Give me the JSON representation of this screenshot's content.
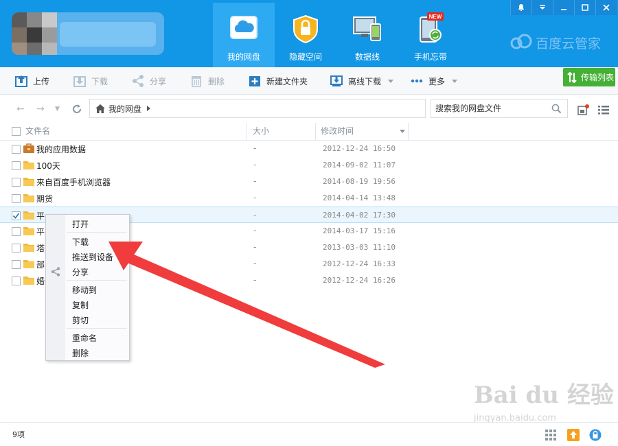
{
  "header": {
    "tabs": [
      {
        "label": "我的网盘",
        "icon": "cloud-drive-icon",
        "active": true
      },
      {
        "label": "隐藏空间",
        "icon": "lock-icon",
        "active": false
      },
      {
        "label": "数据线",
        "icon": "device-sync-icon",
        "active": false
      },
      {
        "label": "手机忘带",
        "icon": "phone-sync-icon",
        "active": false,
        "badge": "NEW"
      }
    ],
    "brand": "百度云管家",
    "window_controls": [
      "bell-icon",
      "dropdown-icon",
      "minimize-icon",
      "maximize-icon",
      "close-icon"
    ]
  },
  "toolbar": {
    "upload": "上传",
    "download": "下载",
    "share": "分享",
    "delete": "删除",
    "new_folder": "新建文件夹",
    "offline_download": "离线下载",
    "more": "更多",
    "transfer_list": "传输列表"
  },
  "address": {
    "breadcrumb": "我的网盘",
    "search_placeholder": "搜索我的网盘文件"
  },
  "list": {
    "columns": {
      "name": "文件名",
      "size": "大小",
      "modified": "修改时间"
    },
    "rows": [
      {
        "name": "我的应用数据",
        "size": "-",
        "time": "2012-12-24 16:50",
        "type": "app-folder",
        "checked": false
      },
      {
        "name": "100天",
        "size": "-",
        "time": "2014-09-02 11:07",
        "type": "folder",
        "checked": false
      },
      {
        "name": "来自百度手机浏览器",
        "size": "-",
        "time": "2014-08-19 19:56",
        "type": "folder",
        "checked": false
      },
      {
        "name": "期货",
        "size": "-",
        "time": "2014-04-14 13:48",
        "type": "folder",
        "checked": false
      },
      {
        "name": "平",
        "size": "-",
        "time": "2014-04-02 17:30",
        "type": "folder",
        "checked": true
      },
      {
        "name": "平",
        "size": "-",
        "time": "2014-03-17 15:16",
        "type": "folder",
        "checked": false
      },
      {
        "name": "塔",
        "size": "-",
        "time": "2013-03-03 11:10",
        "type": "folder",
        "checked": false
      },
      {
        "name": "部",
        "size": "-",
        "time": "2012-12-24 16:33",
        "type": "folder",
        "checked": false
      },
      {
        "name": "婚",
        "size": "-",
        "time": "2012-12-24 16:26",
        "type": "folder",
        "checked": false
      }
    ]
  },
  "context_menu": {
    "items": [
      "打开",
      "下载",
      "推送到设备",
      "分享",
      "移动到",
      "复制",
      "剪切",
      "重命名",
      "删除"
    ]
  },
  "status": {
    "count": "9项"
  },
  "watermark": {
    "big": "Bai du 经验",
    "small": "jingyan.baidu.com"
  },
  "colors": {
    "header_bg": "#1296e6",
    "active_tab": "#2eaaf3",
    "transfer_green": "#45b035",
    "arrow_red": "#f03c3c"
  }
}
